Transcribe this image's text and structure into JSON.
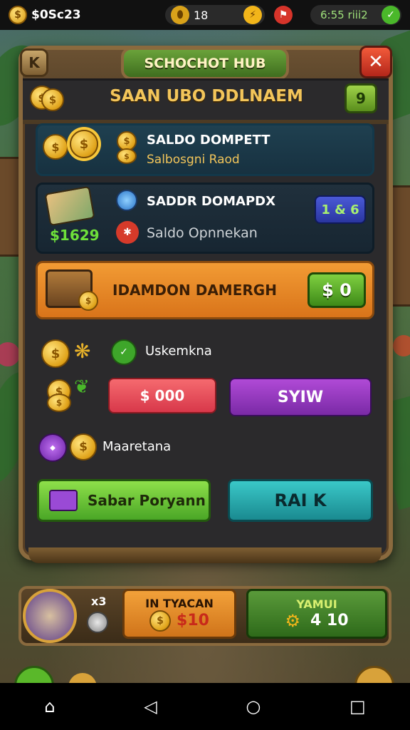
{
  "status": {
    "balance": "$0Sc23",
    "center_value": "18",
    "right_value": "6:55 riii2"
  },
  "panel": {
    "back_label": "K",
    "title": "SCHOCHOT HUB",
    "close_label": "✕",
    "header": "SAAN UBO DDLNAEM",
    "header_btn": "9"
  },
  "card1": {
    "title": "SALDO DOMPETT",
    "subtitle": "Salbosgni Raod"
  },
  "card2": {
    "amount": "$1629",
    "title": "SADDR DOMAPDX",
    "subtitle": "Saldo Opnnekan",
    "badge": "1 & 6"
  },
  "card3": {
    "title": "IDAMDON DAMERGH",
    "button": "$ 0"
  },
  "section1": {
    "label": "Uskemkna",
    "btn_red": "$ 000",
    "btn_purple": "SYIW"
  },
  "section2": {
    "label": "Maaretana",
    "btn_green": "Sabar Poryann",
    "btn_teal": "RAI K"
  },
  "bottom": {
    "multiplier": "x3",
    "mid_title": "IN TYACAN",
    "mid_value": "$10",
    "right_title": "YAMUI",
    "right_value": "4 10"
  },
  "colors": {
    "panel_bg": "#2b2a2c",
    "frame": "#8a6a3e",
    "accent_green": "#5ab82a",
    "accent_orange": "#e8872a",
    "accent_red": "#e2474f",
    "accent_purple": "#8e3ab6",
    "accent_teal": "#2aa5a8"
  }
}
